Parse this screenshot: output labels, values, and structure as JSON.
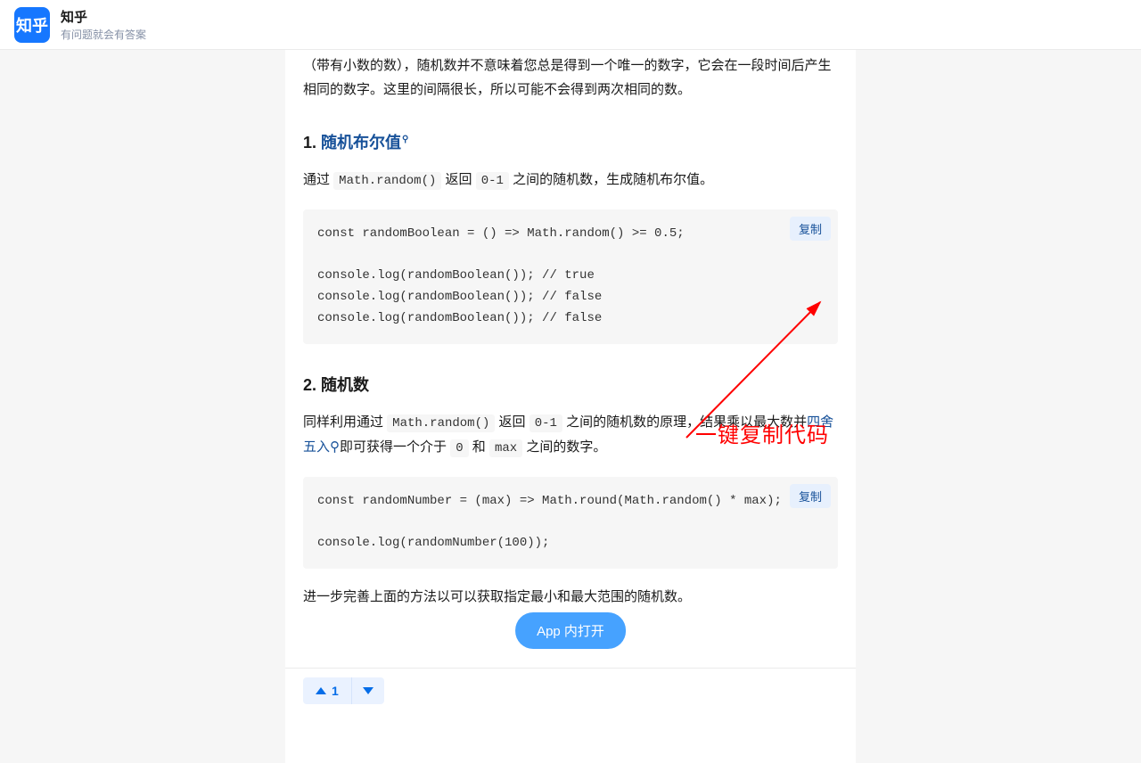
{
  "header": {
    "logo_text": "知乎",
    "brand_name": "知乎",
    "brand_slogan": "有问题就会有答案"
  },
  "article": {
    "intro_partial": "（带有小数的数），随机数并不意味着您总是得到一个唯一的数字，它会在一段时间后产生相同的数字。这里的间隔很长，所以可能不会得到两次相同的数。",
    "section1": {
      "number": "1. ",
      "title": "随机布尔值",
      "desc_pre": "通过 ",
      "code1": "Math.random()",
      "desc_mid": " 返回 ",
      "code2": "0-1",
      "desc_post": " 之间的随机数，生成随机布尔值。",
      "code_block": "const randomBoolean = () => Math.random() >= 0.5;\n\nconsole.log(randomBoolean()); // true\nconsole.log(randomBoolean()); // false\nconsole.log(randomBoolean()); // false",
      "copy_label": "复制"
    },
    "section2": {
      "number": "2. ",
      "title": "随机数",
      "desc_pre": "同样利用通过 ",
      "code1": "Math.random()",
      "desc_mid1": " 返回 ",
      "code2": "0-1",
      "desc_mid2": " 之间的随机数的原理，结果乘以最大数并",
      "link_text": "四舍五入",
      "desc_mid3": "即可获得一个介于 ",
      "code3": "0",
      "desc_mid4": " 和 ",
      "code4": "max",
      "desc_post": " 之间的数字。",
      "code_block": "const randomNumber = (max) => Math.round(Math.random() * max);\n\nconsole.log(randomNumber(100));",
      "copy_label": "复制",
      "tail_text": "进一步完善上面的方法以可以获取指定最小和最大范围的随机数。"
    }
  },
  "annotation": {
    "text": "一键复制代码"
  },
  "open_app": {
    "label": "App 内打开"
  },
  "bottom_bar": {
    "vote_count": "1"
  }
}
